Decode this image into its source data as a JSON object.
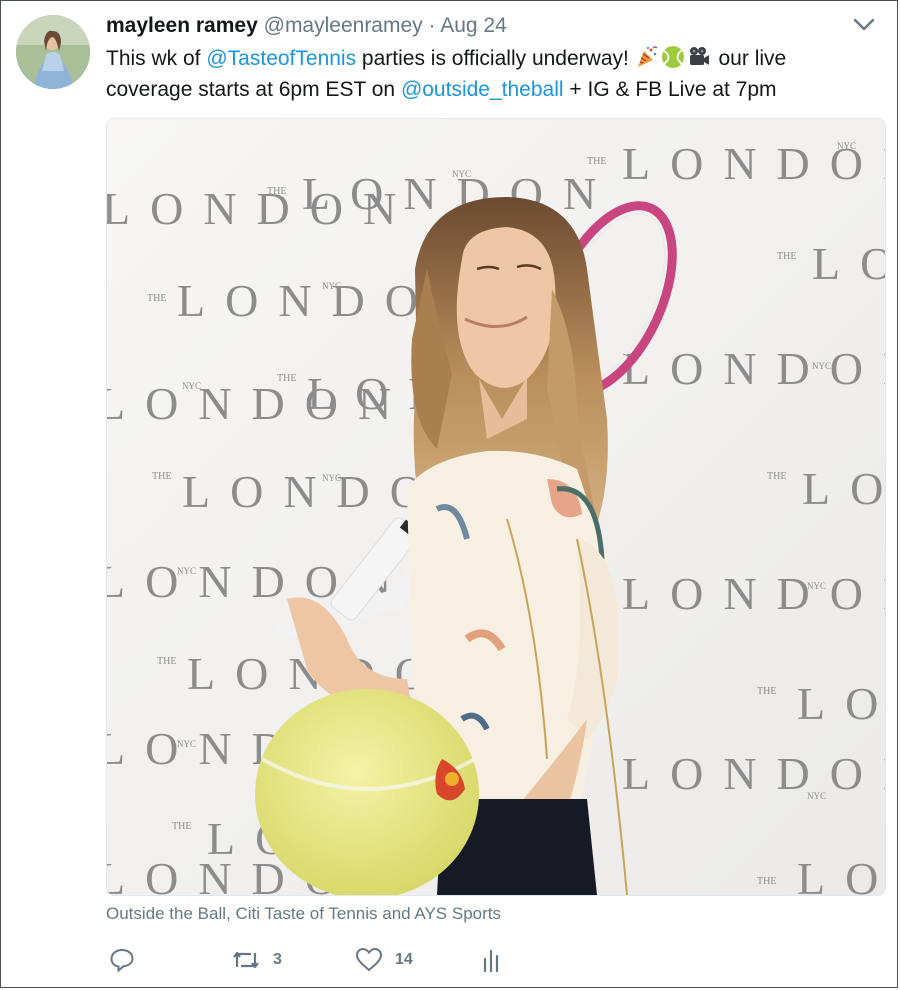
{
  "tweet": {
    "author_name": "mayleen ramey",
    "handle": "@mayleenramey",
    "separator": "·",
    "date": "Aug 24",
    "text": {
      "part1": "This wk of ",
      "mention1": "@TasteofTennis",
      "part2": " parties is officially underway! ",
      "part3": " our live coverage starts at 6pm EST on ",
      "mention2": "@outside_theball",
      "part4": " + IG & FB Live at 7pm"
    },
    "emojis": [
      "party-popper-icon",
      "tennis-ball-icon",
      "movie-camera-icon"
    ],
    "media_caption": "Outside the Ball, Citi Taste of Tennis and AYS Sports",
    "backdrop_text": {
      "the": "THE",
      "london": "LONDON",
      "nyc": "NYC"
    },
    "actions": {
      "reply_count": "",
      "retweet_count": "3",
      "like_count": "14"
    }
  },
  "colors": {
    "link": "#1b95e0",
    "muted": "#657786",
    "text": "#14171a"
  }
}
